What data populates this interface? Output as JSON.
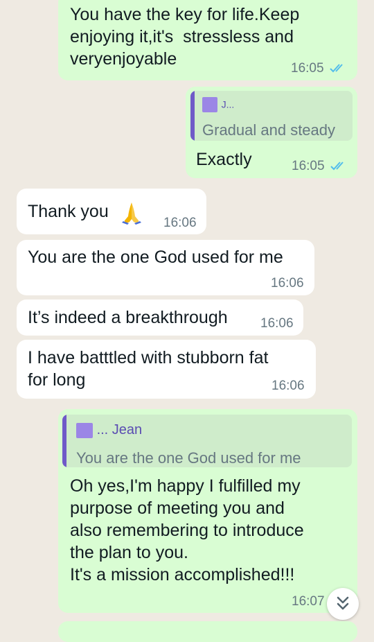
{
  "messages": [
    {
      "id": "m1",
      "dir": "out",
      "text": "You have the key for life.Keep\nenjoying it,it's  stressless and\nveryenjoyable",
      "time": "16:05"
    },
    {
      "id": "m2",
      "dir": "out",
      "quoted": {
        "author": "J...",
        "text": "Gradual and steady"
      },
      "text": "Exactly",
      "time": "16:05"
    },
    {
      "id": "m3",
      "dir": "in",
      "text": "Thank you",
      "emoji": "folded-hands-icon",
      "time": "16:06"
    },
    {
      "id": "m4",
      "dir": "in",
      "text": "You are the one God used for me",
      "time": "16:06"
    },
    {
      "id": "m5",
      "dir": "in",
      "text": "It’s indeed a breakthrough",
      "time": "16:06"
    },
    {
      "id": "m6",
      "dir": "in",
      "text": "I have batttled with stubborn fat\nfor long",
      "time": "16:06"
    },
    {
      "id": "m7",
      "dir": "out",
      "quoted": {
        "author": "... Jean",
        "text": "You are the one God used for me"
      },
      "text": "Oh yes,I'm happy I fulfilled my\npurpose of meeting you and\nalso remembering to introduce\nthe plan to you.\nIt's a mission accomplished!!!",
      "time": "16:07"
    }
  ],
  "colors": {
    "outgoing": "#d9fdd3",
    "incoming": "#ffffff",
    "read_ticks": "#53bdeb",
    "background": "#efeae2"
  },
  "scroll_button_icon": "chevron-double-down-icon"
}
